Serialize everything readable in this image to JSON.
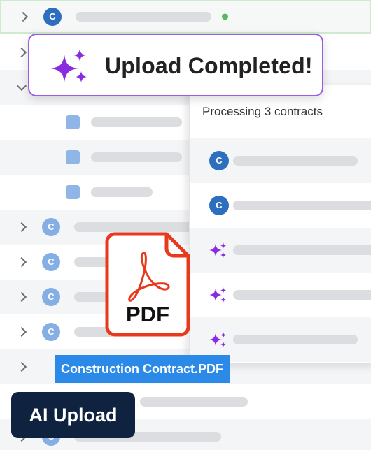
{
  "toast": {
    "message": "Upload Completed!",
    "icon": "sparkles-icon"
  },
  "panel": {
    "title": "Processing 3 contracts",
    "items": [
      {
        "kind": "avatar",
        "initial": "C"
      },
      {
        "kind": "avatar",
        "initial": "C"
      },
      {
        "kind": "sparkle"
      },
      {
        "kind": "sparkle"
      },
      {
        "kind": "sparkle"
      }
    ]
  },
  "list": {
    "avatar_initial": "C"
  },
  "pdf": {
    "label": "PDF",
    "icon": "acrobat-icon"
  },
  "file_tag": {
    "name": "Construction Contract.PDF"
  },
  "ai_upload": {
    "label": "AI Upload"
  },
  "colors": {
    "accent_purple": "#9b5de5",
    "sparkle_purple": "#8a2be2",
    "pdf_red": "#e8391d",
    "brand_blue": "#2b8ae8",
    "navy": "#0f2340",
    "status_green": "#5cb85c"
  }
}
